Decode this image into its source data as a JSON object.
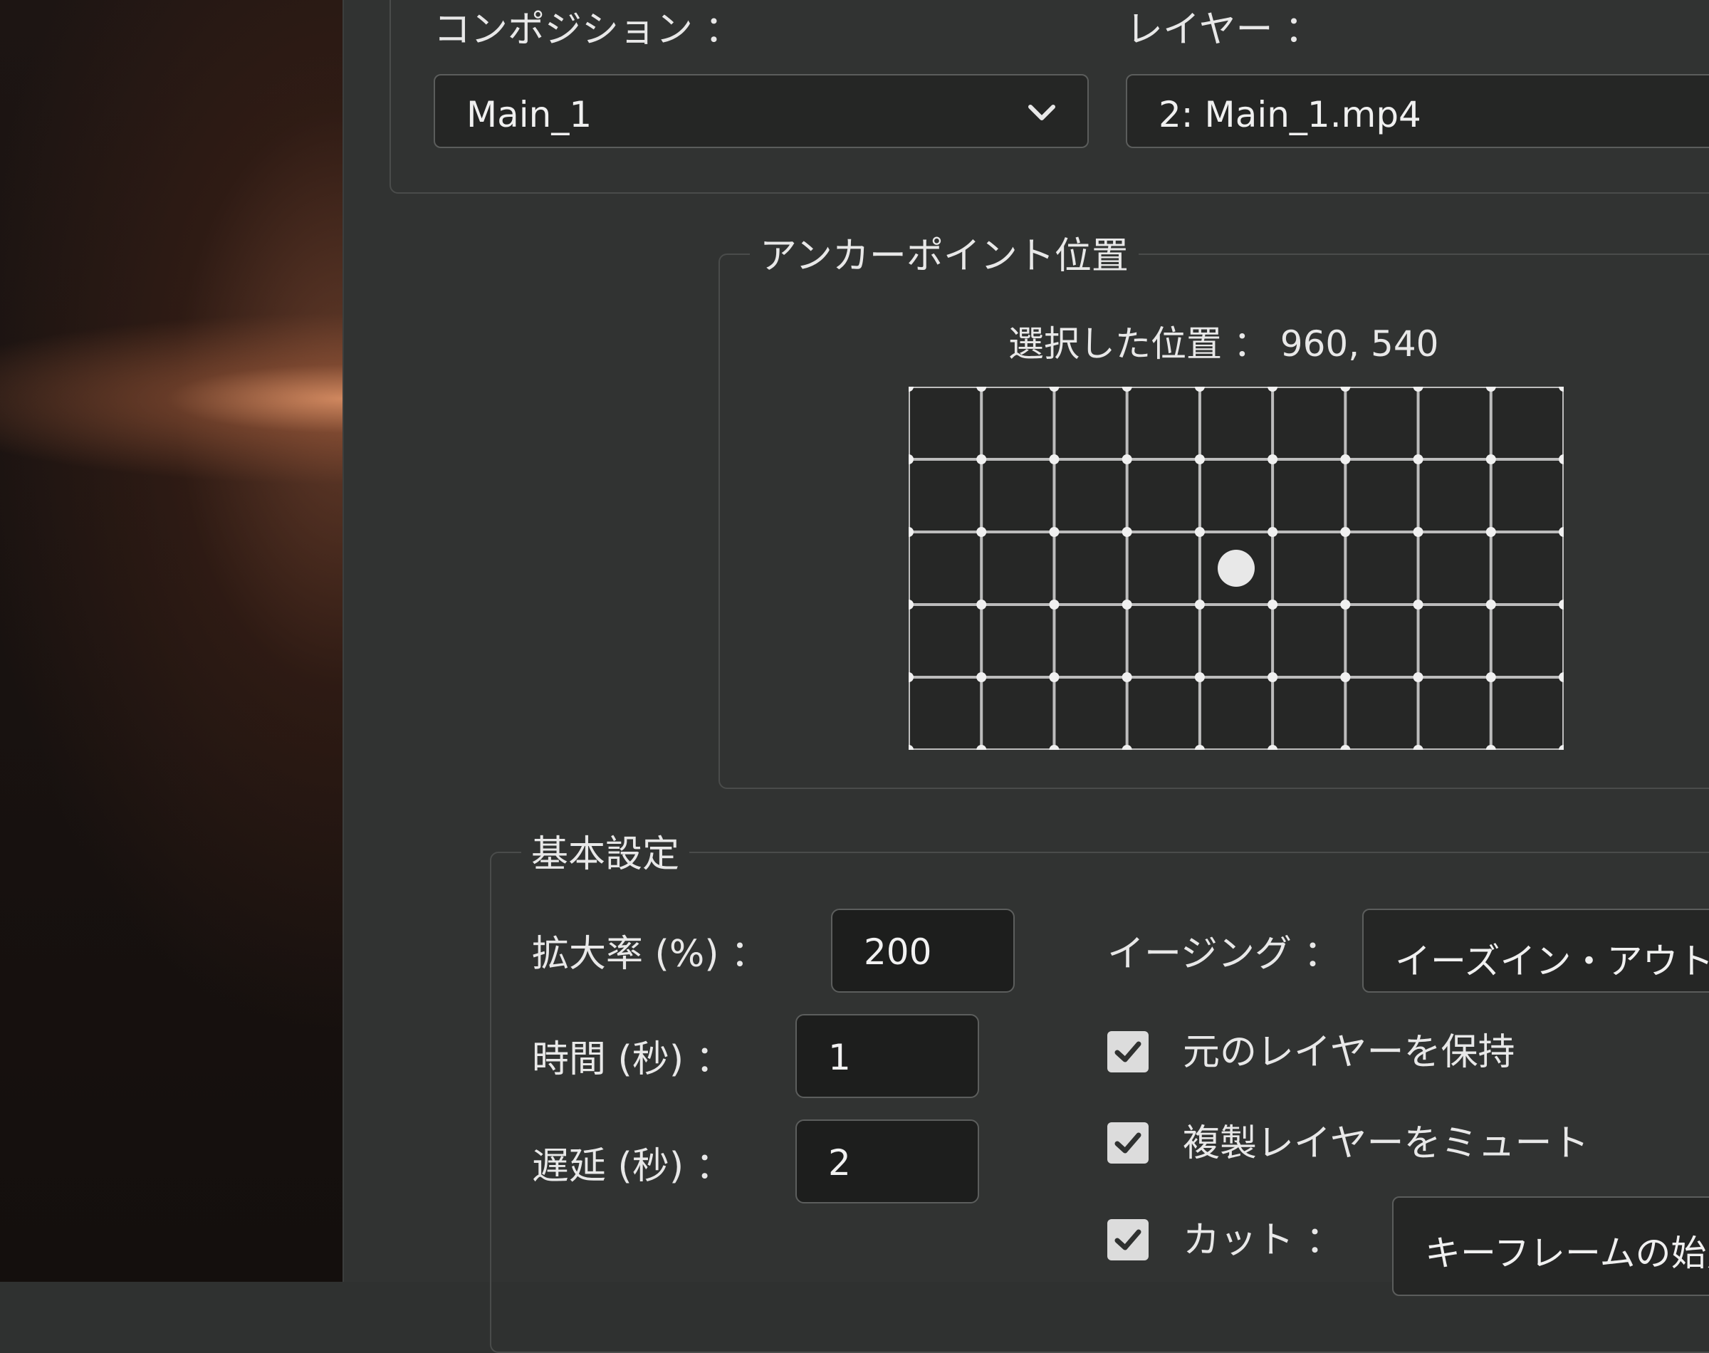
{
  "composition": {
    "label": "コンポジション ：",
    "value": "Main_1"
  },
  "layer": {
    "label": "レイヤー ：",
    "value": "2: Main_1.mp4"
  },
  "anchor": {
    "group_title": "アンカーポイント位置",
    "selected_label": "選択した位置 ： 960, 540"
  },
  "basic": {
    "group_title": "基本設定",
    "scale_label": "拡大率 (%) ：",
    "scale_value": "200",
    "time_label": "時間 (秒) ：",
    "time_value": "1",
    "delay_label": "遅延 (秒) ：",
    "delay_value": "2",
    "easing_label": "イージング ：",
    "easing_value": "イーズイン・アウト",
    "keep_original_label": "元のレイヤーを保持",
    "keep_original_checked": true,
    "mute_duplicate_label": "複製レイヤーをミュート",
    "mute_duplicate_checked": true,
    "cut_label": "カット ：",
    "cut_checked": true,
    "cut_value": "キーフレームの始点"
  },
  "colors": {
    "panel": "#313332",
    "field": "#1d1e1d",
    "accent": "#dcdcdc"
  },
  "icons": [
    "chevron-down-icon",
    "check-icon"
  ]
}
